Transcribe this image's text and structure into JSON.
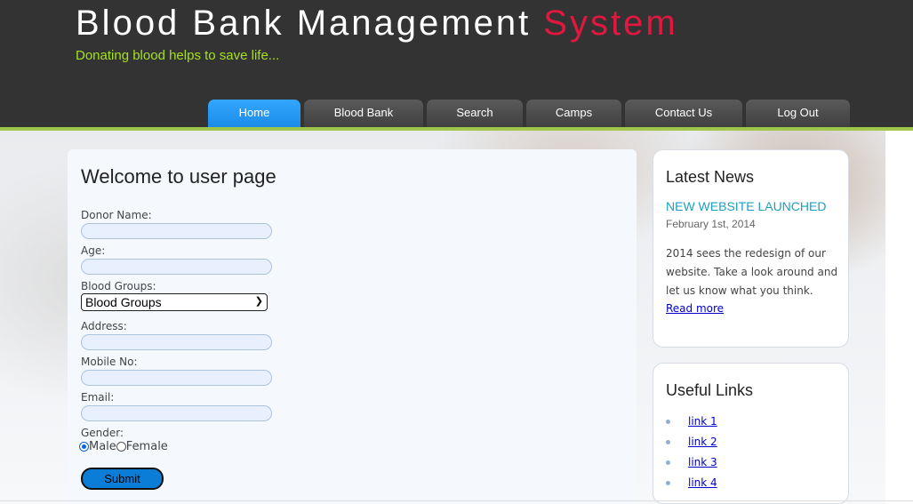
{
  "header": {
    "title_main": "Blood Bank Management ",
    "title_accent": "System",
    "slogan": "Donating blood helps to save life..."
  },
  "nav": {
    "items": [
      {
        "label": "Home",
        "active": true
      },
      {
        "label": "Blood Bank",
        "active": false
      },
      {
        "label": "Search",
        "active": false
      },
      {
        "label": "Camps",
        "active": false
      },
      {
        "label": "Contact Us",
        "active": false
      },
      {
        "label": "Log Out",
        "active": false
      }
    ]
  },
  "form": {
    "heading": "Welcome to user page",
    "donor_name_label": "Donor Name:",
    "donor_name_value": "",
    "age_label": "Age:",
    "age_value": "",
    "blood_groups_label": "Blood Groups:",
    "blood_groups_selected": "Blood Groups",
    "address_label": "Address:",
    "address_value": "",
    "mobile_label": "Mobile No:",
    "mobile_value": "",
    "email_label": "Email:",
    "email_value": "",
    "gender_label": "Gender:",
    "gender_male": "Male",
    "gender_female": "Female",
    "gender_selected": "Male",
    "submit_label": "Submit"
  },
  "news": {
    "heading": "Latest News",
    "title": "NEW WEBSITE LAUNCHED",
    "date": "February 1st, 2014",
    "body": "2014 sees the redesign of our website. Take a look around and let us know what you think.",
    "read_more": "Read more"
  },
  "links": {
    "heading": "Useful Links",
    "items": [
      "link 1",
      "link 2",
      "link 3",
      "link 4"
    ]
  },
  "colors": {
    "header_bg": "#333333",
    "accent_red": "#e0183f",
    "slogan_green": "#a5e020",
    "nav_active": "#1a8ce8",
    "news_title": "#1a9fc0",
    "submit_bg": "#0b7dd6"
  }
}
